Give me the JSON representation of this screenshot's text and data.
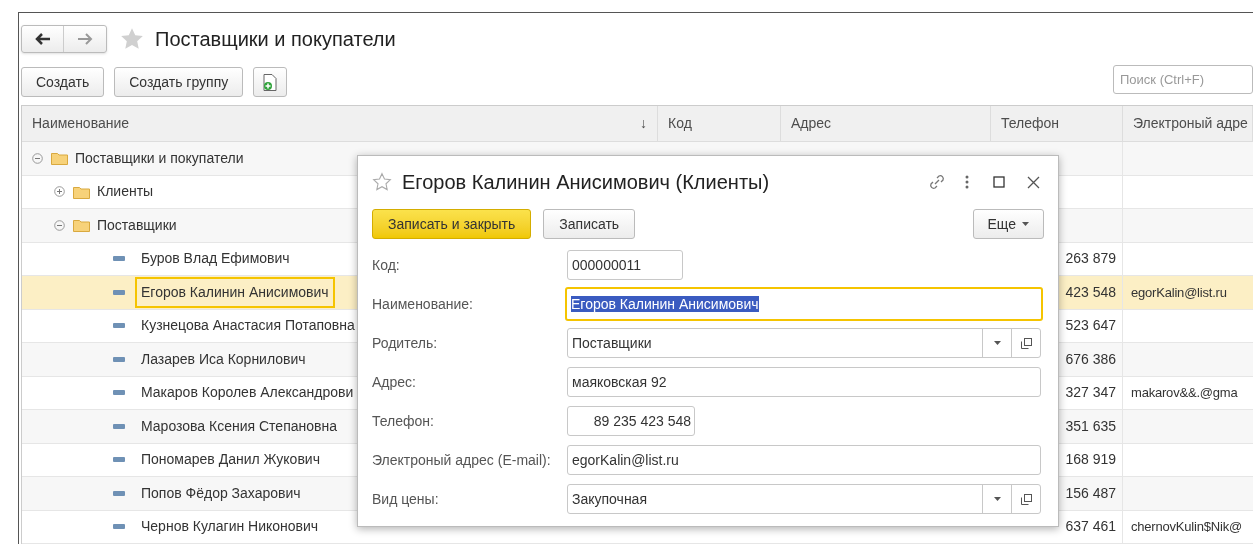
{
  "window": {
    "title": "Поставщики и покупатели",
    "favorite": false
  },
  "toolbar": {
    "buttons": [
      "Создать",
      "Создать группу"
    ]
  },
  "search": {
    "placeholder": "Поиск (Ctrl+F)"
  },
  "table": {
    "columns": [
      {
        "label": "Наименование",
        "sort": "↓"
      },
      {
        "label": "Код"
      },
      {
        "label": "Адрес"
      },
      {
        "label": "Телефон"
      },
      {
        "label": "Электроный адре"
      }
    ],
    "rows": [
      {
        "kind": "group",
        "name": "Поставщики и покупатели",
        "expanded": true,
        "children": [
          {
            "kind": "group",
            "name": "Клиенты",
            "expanded": false
          },
          {
            "kind": "group",
            "name": "Поставщики",
            "expanded": true,
            "children": [
              {
                "kind": "item",
                "name": "Буров Влад Ефимович",
                "selected": false,
                "phone": "263 879"
              },
              {
                "kind": "item",
                "name": "Егоров Калинин Анисимович",
                "selected": true,
                "phone": "423 548",
                "email": "egorKalin@list.ru"
              },
              {
                "kind": "item",
                "name": "Кузнецова Анастасия Потаповна",
                "selected": false,
                "phone": "523 647"
              },
              {
                "kind": "item",
                "name": "Лазарев Иса Корнилович",
                "selected": false,
                "phone": "676 386"
              },
              {
                "kind": "item",
                "name": "Макаров Королев Александрови",
                "selected": false,
                "phone": "327 347",
                "email": "makarov&&.@gma"
              },
              {
                "kind": "item",
                "name": "Марозова Ксения Степановна",
                "selected": false,
                "phone": "351 635"
              },
              {
                "kind": "item",
                "name": "Пономарев Данил Жукович",
                "selected": false,
                "phone": "168 919"
              },
              {
                "kind": "item",
                "name": "Попов Фёдор Захарович",
                "selected": false,
                "phone": "156 487"
              },
              {
                "kind": "item",
                "name": "Чернов Кулагин Никонович",
                "selected": false,
                "phone": "637 461",
                "email": "chernovKulin$Nik@"
              }
            ]
          }
        ]
      }
    ]
  },
  "dialog": {
    "title": "Егоров Калинин Анисимович (Клиенты)",
    "favorite": false,
    "buttons": [
      {
        "label": "Записать и закрыть",
        "primary": true
      },
      {
        "label": "Записать",
        "primary": false
      }
    ],
    "more": "Еще",
    "fields": [
      {
        "label": "Код:",
        "value": "000000011",
        "kind": "short",
        "focused": false
      },
      {
        "label": "Наименование:",
        "value": "Егоров Калинин Анисимович",
        "kind": "text",
        "focused": true
      },
      {
        "label": "Родитель:",
        "value": "Поставщики",
        "kind": "select",
        "focused": false
      },
      {
        "label": "Адрес:",
        "value": "маяковская 92",
        "kind": "text",
        "focused": false
      },
      {
        "label": "Телефон:",
        "value": "89 235 423 548",
        "kind": "phone",
        "focused": false
      },
      {
        "label": "Электроный адрес (E-mail):",
        "value": "egorKalin@list.ru",
        "kind": "text",
        "focused": false
      },
      {
        "label": "Вид цены:",
        "value": "Закупочная",
        "kind": "select",
        "focused": false
      }
    ]
  }
}
